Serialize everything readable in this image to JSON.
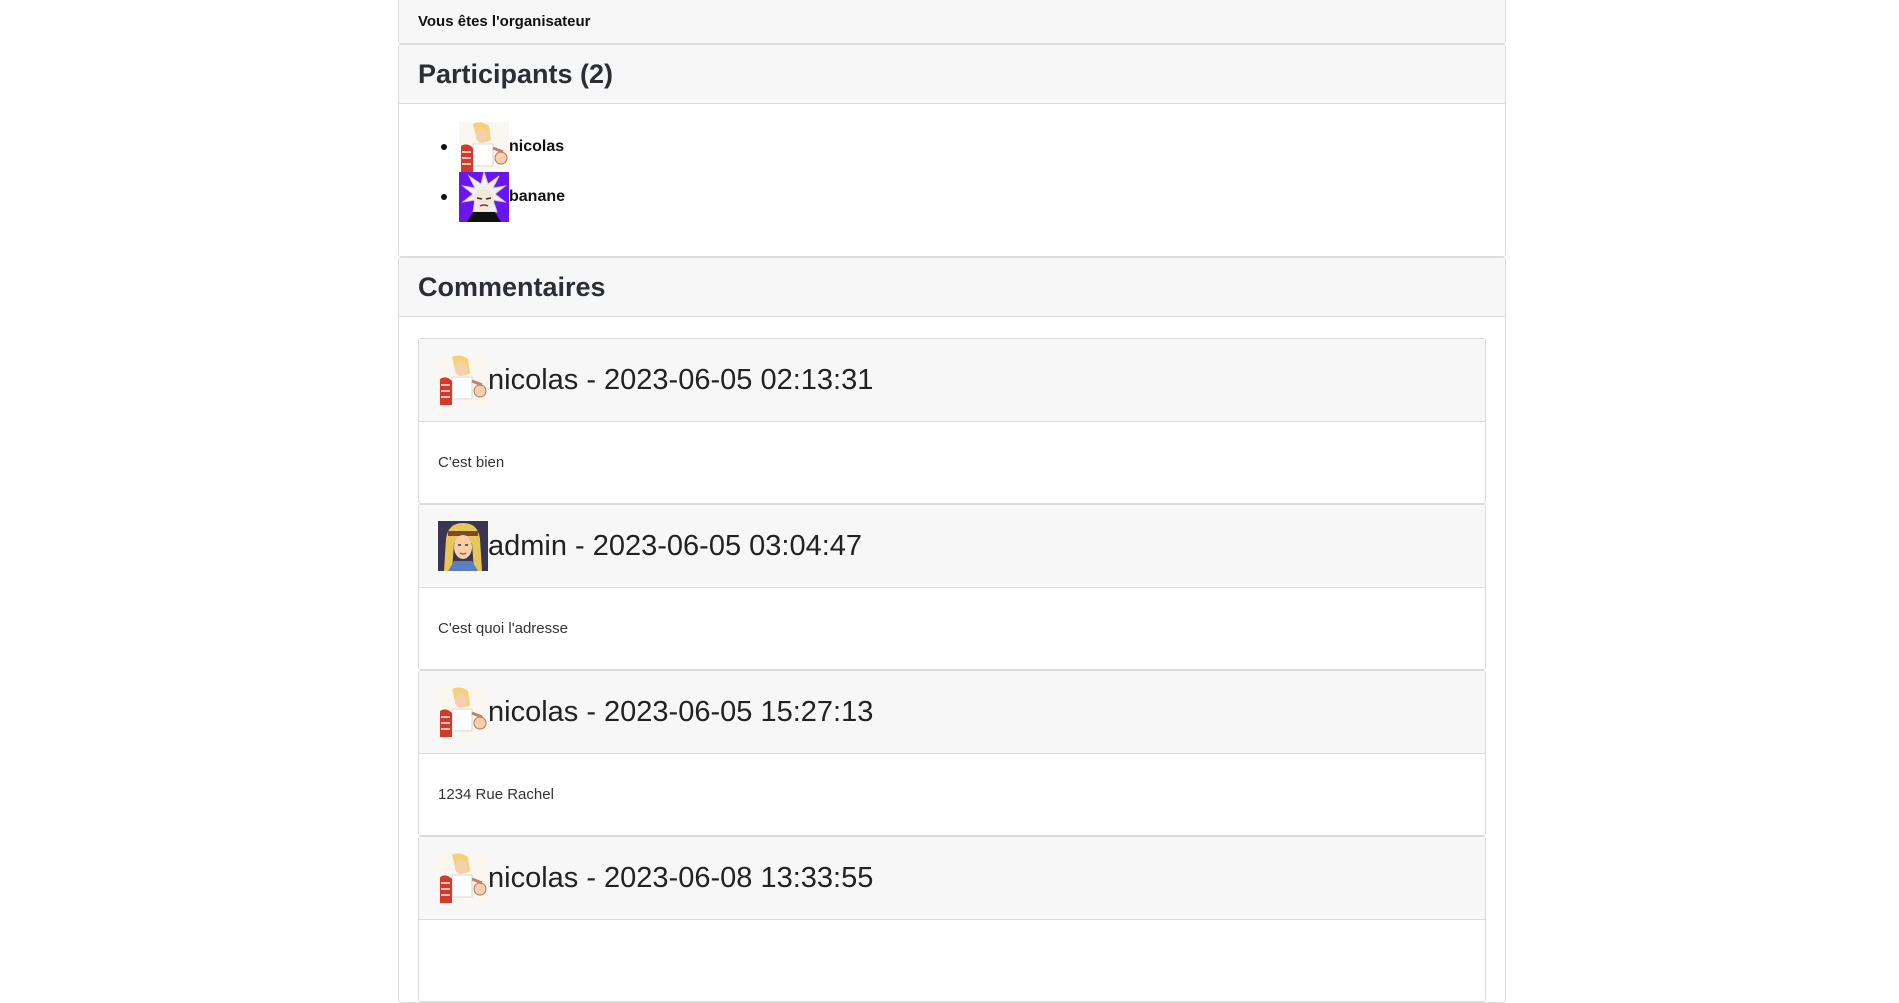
{
  "organizer": {
    "label": "Vous êtes l'organisateur"
  },
  "participants": {
    "title": "Participants (2)",
    "items": [
      {
        "name": "nicolas",
        "avatar": "blonde-fighter-avatar"
      },
      {
        "name": "banane",
        "avatar": "white-haired-purple-avatar"
      }
    ]
  },
  "comments": {
    "title": "Commentaires",
    "items": [
      {
        "author": "nicolas",
        "date": "2023-06-05 02:13:31",
        "heading": "nicolas - 2023-06-05 02:13:31",
        "body": "C'est bien",
        "avatar": "blonde-fighter-avatar"
      },
      {
        "author": "admin",
        "date": "2023-06-05 03:04:47",
        "heading": "admin - 2023-06-05 03:04:47",
        "body": "C'est quoi l'adresse",
        "avatar": "blonde-hero-avatar"
      },
      {
        "author": "nicolas",
        "date": "2023-06-05 15:27:13",
        "heading": "nicolas - 2023-06-05 15:27:13",
        "body": "1234 Rue Rachel",
        "avatar": "blonde-fighter-avatar"
      },
      {
        "author": "nicolas",
        "date": "2023-06-08 13:33:55",
        "heading": "nicolas - 2023-06-08 13:33:55",
        "body": "",
        "avatar": "blonde-fighter-avatar"
      }
    ]
  },
  "colors": {
    "header_bg": "#f7f7f7",
    "border": "#dcdcdc",
    "text": "#212529"
  }
}
